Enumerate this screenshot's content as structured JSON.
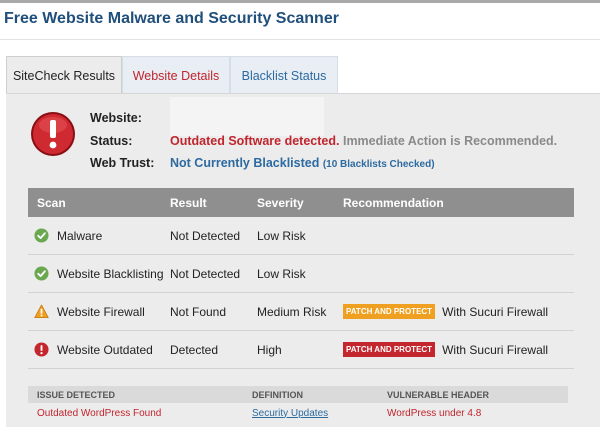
{
  "page": {
    "title": "Free Website Malware and Security Scanner"
  },
  "tabs": [
    {
      "label": "SiteCheck Results",
      "active": true
    },
    {
      "label": "Website Details",
      "active": false
    },
    {
      "label": "Blacklist Status",
      "active": false
    }
  ],
  "summary": {
    "alert_icon": "alert-icon",
    "website_label": "Website:",
    "website_value": "",
    "status_label": "Status:",
    "status_main": "Outdated Software detected.",
    "status_note": "Immediate Action is Recommended.",
    "trust_label": "Web Trust:",
    "trust_main": "Not Currently Blacklisted",
    "trust_sub": "(10 Blacklists Checked)"
  },
  "scan_table": {
    "headers": [
      "Scan",
      "Result",
      "Severity",
      "Recommendation"
    ],
    "rows": [
      {
        "icon": "check-icon",
        "scan": "Malware",
        "result": "Not Detected",
        "severity": "Low Risk",
        "badge": "",
        "recommendation": ""
      },
      {
        "icon": "check-icon",
        "scan": "Website Blacklisting",
        "result": "Not Detected",
        "severity": "Low Risk",
        "badge": "",
        "recommendation": ""
      },
      {
        "icon": "warning-icon",
        "scan": "Website Firewall",
        "result": "Not Found",
        "severity": "Medium Risk",
        "badge": "PATCH AND PROTECT",
        "recommendation": "With Sucuri Firewall"
      },
      {
        "icon": "error-icon",
        "scan": "Website Outdated",
        "result": "Detected",
        "severity": "High",
        "badge": "PATCH AND PROTECT",
        "recommendation": "With Sucuri Firewall"
      }
    ]
  },
  "issue_table": {
    "headers": [
      "ISSUE DETECTED",
      "DEFINITION",
      "VULNERABLE HEADER"
    ],
    "rows": [
      {
        "issue": "Outdated WordPress Found",
        "definition": "Security Updates",
        "header": "WordPress under 4.8"
      }
    ]
  },
  "colors": {
    "title_blue": "#1f4f7a",
    "danger_red": "#c0252d",
    "link_blue": "#2c6aa0",
    "warning_orange": "#f0a020",
    "success_green": "#6aa84f"
  }
}
